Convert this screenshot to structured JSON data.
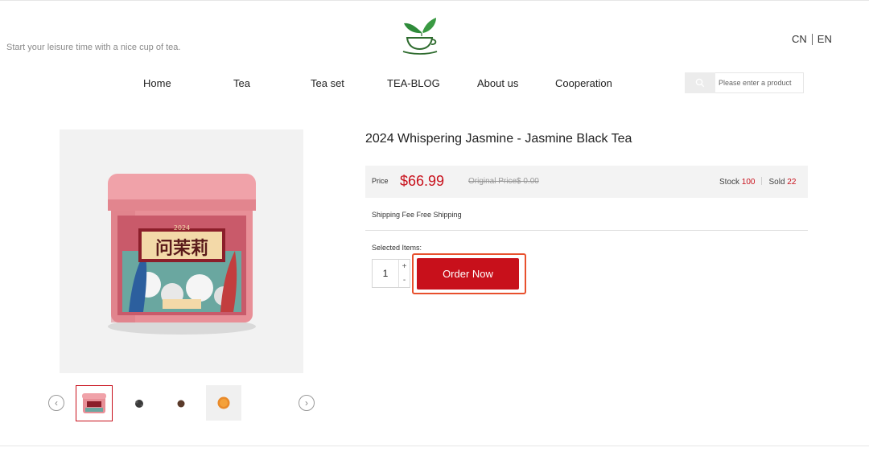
{
  "header": {
    "tagline": "Start your leisure time with a nice cup of tea.",
    "logo_icon": "teacup-leaf-logo",
    "lang": {
      "cn": "CN",
      "en": "EN"
    }
  },
  "nav": {
    "items": [
      {
        "label": "Home"
      },
      {
        "label": "Tea"
      },
      {
        "label": "Tea set"
      },
      {
        "label": "TEA-BLOG"
      },
      {
        "label": "About us"
      },
      {
        "label": "Cooperation"
      }
    ]
  },
  "search": {
    "placeholder": "Please enter a product",
    "icon": "search-icon"
  },
  "gallery": {
    "tin_label_year": "2024",
    "tin_label_name": "问茉莉",
    "thumbnails": [
      {
        "name": "thumb-tin",
        "active": true
      },
      {
        "name": "thumb-loose-leaf",
        "active": false
      },
      {
        "name": "thumb-dry-leaf",
        "active": false
      },
      {
        "name": "thumb-brewed-tea",
        "active": false
      }
    ]
  },
  "product": {
    "title": "2024 Whispering Jasmine - Jasmine Black Tea",
    "price_label": "Price",
    "price": "$66.99",
    "original_price": "Original Price$ 0.00",
    "stock_label": "Stock",
    "stock": "100",
    "sold_label": "Sold",
    "sold": "22",
    "shipping": "Shipping Fee Free Shipping",
    "selected_items_label": "Selected Items:",
    "quantity": "1",
    "plus": "+",
    "minus": "-",
    "order_label": "Order Now"
  },
  "colors": {
    "accent": "#c8101b",
    "highlight": "#e8502d",
    "tin_pink": "#e88f97"
  }
}
